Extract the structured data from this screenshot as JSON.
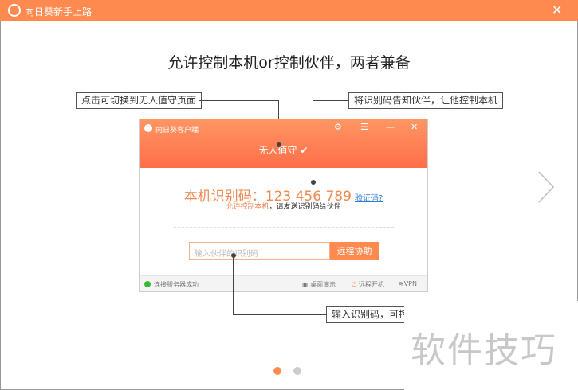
{
  "window": {
    "title": "向日葵新手上路",
    "close": "✕"
  },
  "headline": "允许控制本机or控制伙伴，两者兼备",
  "callouts": [
    "点击可切换到无人值守页面",
    "将识别码告知伙伴，让他控制本机",
    "输入识别码，可控"
  ],
  "client": {
    "title": "向日葵客户端",
    "icons": [
      "gear-icon",
      "menu-icon",
      "minimize-icon",
      "close-icon"
    ],
    "mode": "无人值守",
    "id_label": "本机识别码：",
    "id_value": "123 456 789",
    "verify_link": "验证码?",
    "sub_highlight": "允许控制本机",
    "sub_rest": "，请发送识别码给伙伴",
    "input_placeholder": "输入伙伴的识别码",
    "assist_button": "远程协助",
    "status": "连接服务器成功",
    "footer": [
      "桌面演示",
      "远程开机",
      "VPN"
    ]
  },
  "watermark": "软件技巧",
  "pager": {
    "pages": 2,
    "current": 1
  },
  "colors": {
    "accent": "#ff8a50",
    "status_ok": "#3bb83b",
    "link": "#2c7ed6"
  }
}
